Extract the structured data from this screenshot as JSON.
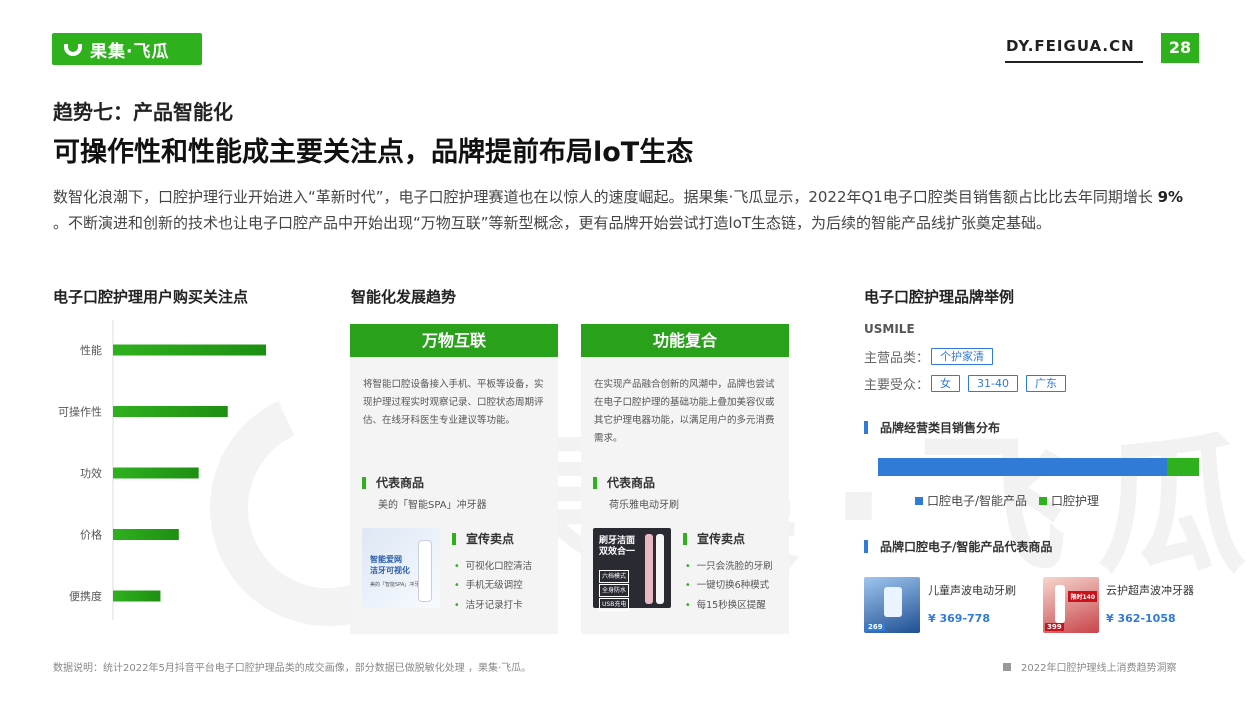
{
  "header": {
    "logo_text": "果集·飞瓜",
    "site": "DY.FEIGUA.CN",
    "page_number": "28",
    "brand_color": "#2fb11e"
  },
  "kicker": "趋势七：产品智能化",
  "title": "可操作性和性能成主要关注点，品牌提前布局loT生态",
  "intro": {
    "part1": "数智化浪潮下，口腔护理行业开始进入“革新时代”，电子口腔护理赛道也在以惊人的速度崛起。据果集·飞瓜显示，2022年Q1电子口腔类目销售额占比比去年同期增长 ",
    "highlight": "9%",
    "part2": " 。不断演进和创新的技术也让电子口腔产品中开始出现“万物互联”等新型概念，更有品牌开始尝试打造loT生态链，为后续的智能产品线扩张奠定基础。"
  },
  "watermark": "果集·飞瓜",
  "left_section_title": "电子口腔护理用户购买关注点",
  "chart_data": {
    "type": "bar",
    "orientation": "horizontal",
    "categories": [
      "性能",
      "可操作性",
      "功效",
      "价格",
      "便携度"
    ],
    "values": [
      100,
      75,
      56,
      43,
      31
    ],
    "xlim": [
      0,
      100
    ],
    "grid": false,
    "color": "#2fb11e"
  },
  "middle_section_title": "智能化发展趋势",
  "cards": [
    {
      "title": "万物互联",
      "desc": "将智能口腔设备接入手机、平板等设备，实现护理过程实时观察记录、口腔状态周期评估、在线牙科医生专业建议等功能。",
      "rep_label": "代表商品",
      "product": "美的「智能SPA」冲牙器",
      "points_label": "宣传卖点",
      "points": [
        "可视化口腔清洁",
        "手机无级调控",
        "洁牙记录打卡"
      ],
      "img_lines": [
        "智能爱网",
        "洁牙可视化",
        "美的「智能SPA」冲牙器"
      ]
    },
    {
      "title": "功能复合",
      "desc": "在实现产品融合创新的风潮中，品牌也尝试在电子口腔护理的基础功能上叠加美容仪或其它护理电器功能，以满足用户的多元消费需求。",
      "rep_label": "代表商品",
      "product": "荷乐雅电动牙刷",
      "points_label": "宣传卖点",
      "points": [
        "一只会洗脸的牙刷",
        "一键切换6种模式",
        "每15秒换区提醒"
      ],
      "img_lines": [
        "刷牙洁面",
        "双效合一",
        "六档模式",
        "全身防水",
        "USB充电"
      ]
    }
  ],
  "right_section_title": "电子口腔护理品牌举例",
  "brand": {
    "name": "USMILE",
    "category_label": "主营品类：",
    "category_tags": [
      "个护家清"
    ],
    "audience_label": "主要受众：",
    "audience_tags": [
      "女",
      "31-40",
      "广东"
    ],
    "dist_title": "品牌经营类目销售分布",
    "distribution": [
      {
        "name": "口腔电子/智能产品",
        "share": 0.9,
        "color": "#2f7bd6"
      },
      {
        "name": "口腔护理",
        "share": 0.1,
        "color": "#2fb11e"
      }
    ],
    "products_title": "品牌口腔电子/智能产品代表商品",
    "products": [
      {
        "name": "儿童声波电动牙刷",
        "price": "¥ 369-778",
        "img_price": "269"
      },
      {
        "name": "云护超声波冲牙器",
        "price": "¥ 362-1058",
        "img_price": "399",
        "img_tag": "限时140"
      }
    ]
  },
  "footnote": "数据说明：统计2022年5月抖音平台电子口腔护理品类的成交画像，部分数据已做脱敏化处理 ，果集·飞瓜。",
  "footer_right": "2022年口腔护理线上消费趋势洞察"
}
